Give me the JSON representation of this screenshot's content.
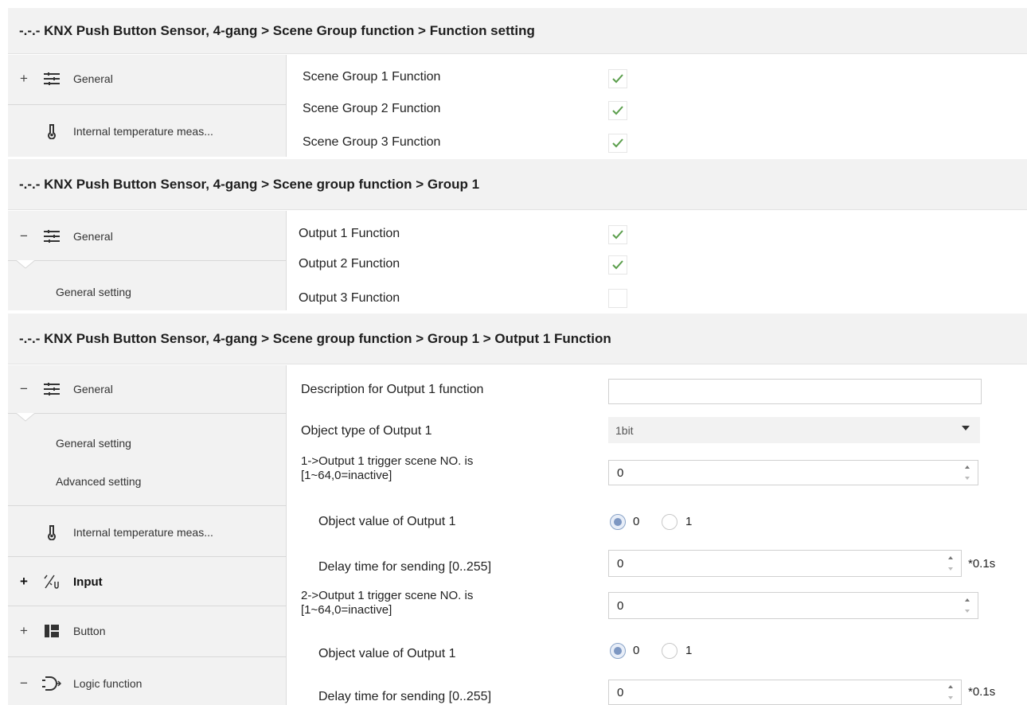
{
  "panel1": {
    "header": "-.-.- KNX Push Button Sensor, 4-gang > Scene Group function > Function setting",
    "sidebar": [
      {
        "sign": "+",
        "icon": "sliders-icon",
        "label": "General"
      },
      {
        "sign": "",
        "icon": "thermometer-icon",
        "label": "Internal temperature meas..."
      }
    ],
    "rows": [
      {
        "label": "Scene Group 1 Function",
        "checked": true
      },
      {
        "label": "Scene Group 2 Function",
        "checked": true
      },
      {
        "label": "Scene Group 3 Function",
        "checked": true
      }
    ]
  },
  "panel2": {
    "header": "-.-.- KNX Push Button Sensor, 4-gang > Scene group function > Group 1",
    "sidebar": [
      {
        "sign": "−",
        "icon": "sliders-icon",
        "label": "General"
      },
      {
        "sign": "",
        "icon": "",
        "label": "General setting"
      }
    ],
    "rows": [
      {
        "label": "Output 1 Function",
        "checked": true
      },
      {
        "label": "Output 2 Function",
        "checked": true
      },
      {
        "label": "Output 3 Function",
        "checked": false
      }
    ]
  },
  "panel3": {
    "header": "-.-.- KNX Push Button Sensor, 4-gang > Scene group function > Group 1 > Output 1 Function",
    "sidebar": [
      {
        "sign": "−",
        "icon": "sliders-icon",
        "label": "General"
      },
      {
        "sign": "",
        "icon": "",
        "label": "General setting"
      },
      {
        "sign": "",
        "icon": "",
        "label": "Advanced setting"
      },
      {
        "sign": "",
        "icon": "thermometer-icon",
        "label": "Internal temperature meas..."
      },
      {
        "sign": "+",
        "icon": "input-icon",
        "label": "Input"
      },
      {
        "sign": "+",
        "icon": "button-icon",
        "label": "Button"
      },
      {
        "sign": "−",
        "icon": "logic-icon",
        "label": "Logic function"
      }
    ],
    "params": {
      "description_label": "Description for Output 1 function",
      "description_value": "",
      "object_type_label": "Object type of Output 1",
      "object_type_value": "1bit",
      "trigger1_label_line1": "1->Output 1 trigger scene NO. is",
      "trigger1_label_line2": "[1~64,0=inactive]",
      "trigger1_value": "0",
      "objval1_label": "Object value of Output 1",
      "objval1_options": [
        "0",
        "1"
      ],
      "objval1_selected": "0",
      "delay1_label": "Delay time for sending [0..255]",
      "delay1_value": "0",
      "delay1_unit": "*0.1s",
      "trigger2_label_line1": "2->Output 1 trigger scene NO. is",
      "trigger2_label_line2": "[1~64,0=inactive]",
      "trigger2_value": "0",
      "objval2_label": "Object value of Output 1",
      "objval2_options": [
        "0",
        "1"
      ],
      "objval2_selected": "0",
      "delay2_label": "Delay time for sending [0..255]",
      "delay2_value": "0",
      "delay2_unit": "*0.1s"
    }
  },
  "colors": {
    "check": "#5a9e4b",
    "header_bg": "#f2f2f2",
    "sidebar_bg": "#f2f2f2"
  }
}
